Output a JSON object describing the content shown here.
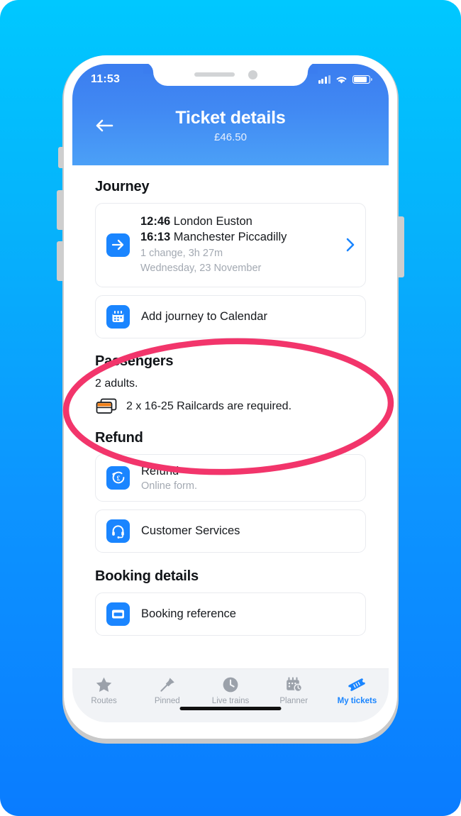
{
  "status_bar": {
    "time": "11:53",
    "signal_icon": "signal-bars-icon",
    "wifi_icon": "wifi-icon",
    "battery_icon": "battery-icon"
  },
  "header": {
    "title": "Ticket details",
    "price": "£46.50",
    "back_icon": "back-arrow-icon",
    "gradient_from": "#3b7def",
    "gradient_to": "#4ba0f7"
  },
  "sections": {
    "journey": {
      "title": "Journey",
      "card": {
        "icon": "arrow-right-icon",
        "depart_time": "12:46",
        "depart_station": "London Euston",
        "arrive_time": "16:13",
        "arrive_station": "Manchester Piccadilly",
        "detail": "1 change, 3h 27m",
        "date": "Wednesday, 23 November",
        "chevron_icon": "chevron-right-icon"
      },
      "calendar_row": {
        "icon": "calendar-icon",
        "label": "Add journey to Calendar"
      }
    },
    "passengers": {
      "title": "Passengers",
      "count_line": "2 adults.",
      "railcard_icon": "railcard-icon",
      "railcard_line": "2 x 16-25 Railcards are required."
    },
    "refund": {
      "title": "Refund",
      "rows": [
        {
          "icon": "refund-pound-icon",
          "label": "Refund",
          "sub": "Online form."
        },
        {
          "icon": "headset-icon",
          "label": "Customer Services",
          "sub": ""
        }
      ]
    },
    "booking": {
      "title": "Booking details",
      "row": {
        "icon": "booking-reference-icon",
        "label": "Booking reference"
      }
    }
  },
  "tabbar": {
    "items": [
      {
        "icon": "star-icon",
        "label": "Routes",
        "active": false
      },
      {
        "icon": "pin-icon",
        "label": "Pinned",
        "active": false
      },
      {
        "icon": "clock-icon",
        "label": "Live trains",
        "active": false
      },
      {
        "icon": "planner-icon",
        "label": "Planner",
        "active": false
      },
      {
        "icon": "ticket-icon",
        "label": "My tickets",
        "active": true
      }
    ],
    "active_color": "#1a85ff",
    "inactive_color": "#9ba1aa"
  },
  "annotation": {
    "shape": "ellipse",
    "color": "#f2356b",
    "stroke_width": 8
  },
  "theme": {
    "accent": "#1a85ff",
    "background_from": "#00c8ff",
    "background_to": "#0a7cff",
    "railcard_stripe": "#f08019"
  }
}
